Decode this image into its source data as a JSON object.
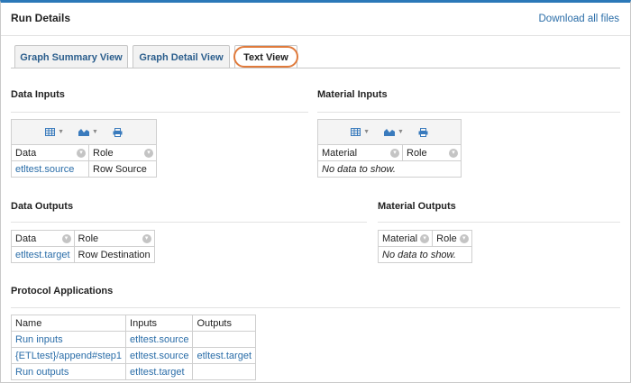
{
  "header": {
    "title": "Run Details",
    "download_label": "Download all files"
  },
  "tabs": [
    {
      "label": "Graph Summary View"
    },
    {
      "label": "Graph Detail View"
    },
    {
      "label": "Text View"
    }
  ],
  "data_inputs": {
    "title": "Data Inputs",
    "col_data": "Data",
    "col_role": "Role",
    "row": {
      "data": "etltest.source",
      "role": "Row Source"
    }
  },
  "material_inputs": {
    "title": "Material Inputs",
    "col_material": "Material",
    "col_role": "Role",
    "empty": "No data to show."
  },
  "data_outputs": {
    "title": "Data Outputs",
    "col_data": "Data",
    "col_role": "Role",
    "row": {
      "data": "etltest.target",
      "role": "Row Destination"
    }
  },
  "material_outputs": {
    "title": "Material Outputs",
    "col_material": "Material",
    "col_role": "Role",
    "empty": "No data to show."
  },
  "protocol": {
    "title": "Protocol Applications",
    "headers": {
      "name": "Name",
      "inputs": "Inputs",
      "outputs": "Outputs"
    },
    "rows": [
      {
        "name": "Run inputs",
        "inputs": "etltest.source",
        "outputs": ""
      },
      {
        "name": "{ETLtest}/append#step1",
        "inputs": "etltest.source",
        "outputs": "etltest.target"
      },
      {
        "name": "Run outputs",
        "inputs": "etltest.target",
        "outputs": ""
      }
    ]
  },
  "icons": {
    "grid": "grid-icon",
    "chart": "chart-icon",
    "print": "print-icon",
    "sort": "column-menu-icon"
  },
  "colors": {
    "link": "#2a6da8",
    "accent_bar": "#2b78b8",
    "highlight": "#e07a3b"
  }
}
